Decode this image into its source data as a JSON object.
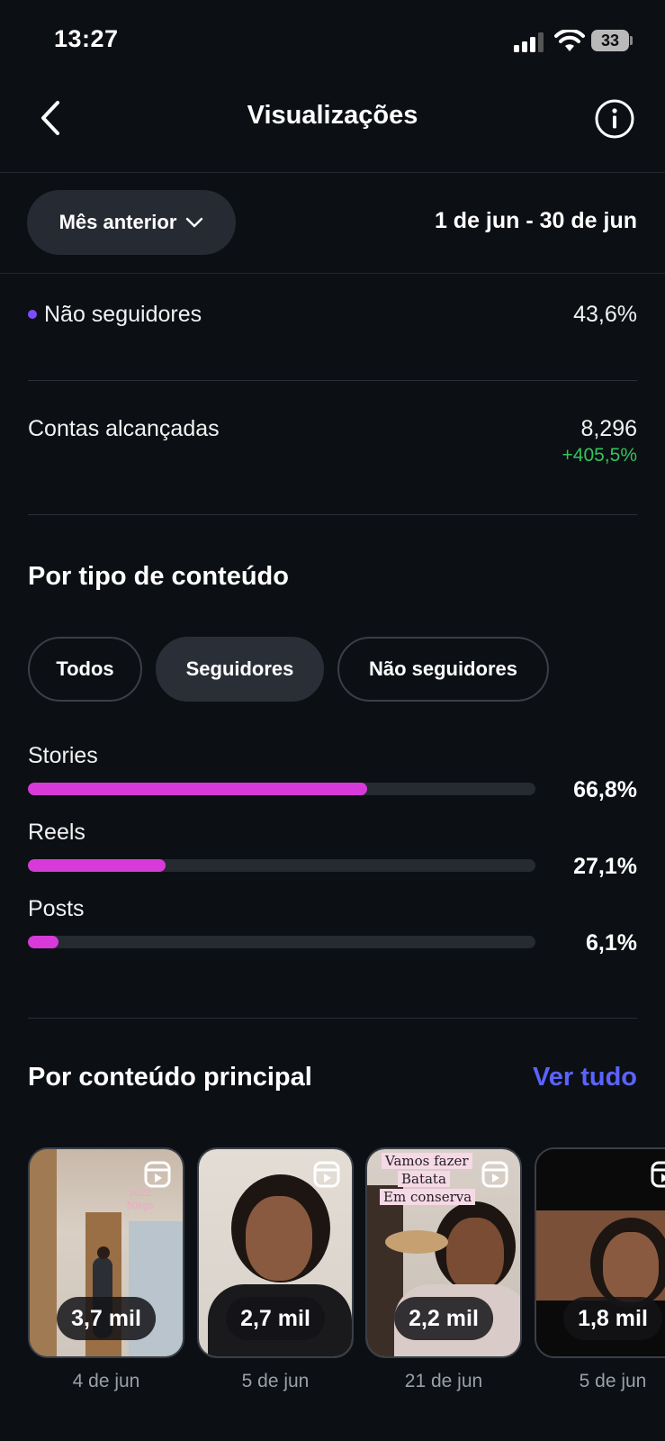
{
  "status_bar": {
    "time": "13:27",
    "battery": "33"
  },
  "header": {
    "title": "Visualizações"
  },
  "filter": {
    "period_label": "Mês anterior",
    "date_range": "1 de jun - 30 de jun"
  },
  "stats": {
    "non_followers": {
      "label": "Não seguidores",
      "value": "43,6%"
    },
    "accounts_reached": {
      "label": "Contas alcançadas",
      "value": "8,296",
      "change": "+405,5%"
    }
  },
  "content_type": {
    "title": "Por tipo de conteúdo",
    "chips": [
      "Todos",
      "Seguidores",
      "Não seguidores"
    ],
    "active_chip": "Seguidores",
    "bars": [
      {
        "label": "Stories",
        "value": "66,8%",
        "percent": 66.8
      },
      {
        "label": "Reels",
        "value": "27,1%",
        "percent": 27.1
      },
      {
        "label": "Posts",
        "value": "6,1%",
        "percent": 6.1
      }
    ],
    "bar_color": "#d73ad8"
  },
  "top_content": {
    "title": "Por conteúdo principal",
    "see_all": "Ver tudo",
    "items": [
      {
        "views": "3,7 mil",
        "date": "4 de jun",
        "overlay_text": [
          "2022",
          "50kgs"
        ]
      },
      {
        "views": "2,7 mil",
        "date": "5 de jun"
      },
      {
        "views": "2,2 mil",
        "date": "21 de jun",
        "overlay_text": [
          "Vamos fazer",
          "Batata",
          "Em conserva"
        ]
      },
      {
        "views": "1,8 mil",
        "date": "5 de jun"
      }
    ]
  },
  "colors": {
    "background": "#0c0f14",
    "accent_link": "#5b63ff",
    "positive": "#33c45a",
    "dot": "#7c4dff"
  }
}
